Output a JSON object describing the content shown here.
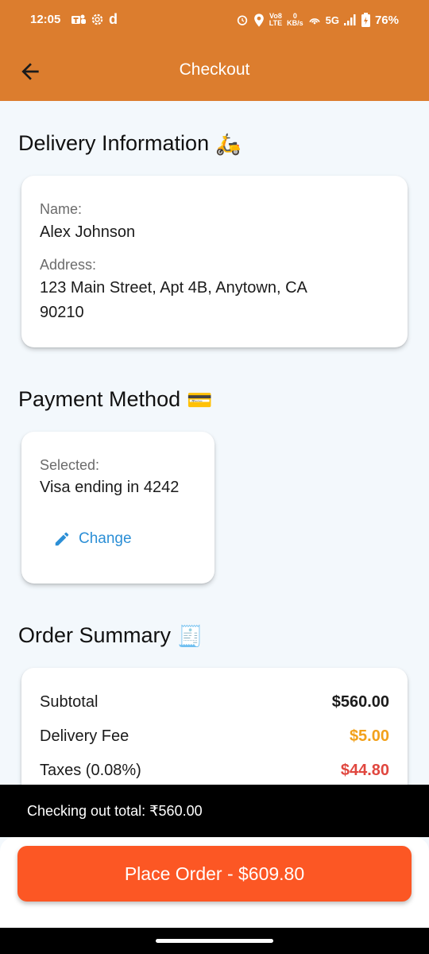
{
  "status_bar": {
    "time": "12:05",
    "left_icons": [
      "teams-icon",
      "settings-gear-icon",
      "d-icon"
    ],
    "volte": "Vo8\nLTE",
    "speed": "0\nKB/s",
    "network": "5G",
    "battery": "76%"
  },
  "appbar": {
    "title": "Checkout"
  },
  "delivery": {
    "title": "Delivery Information",
    "emoji": "🛵",
    "name_label": "Name:",
    "name_value": "Alex Johnson",
    "address_label": "Address:",
    "address_line1": "123 Main Street, Apt 4B, Anytown, CA",
    "address_line2": "90210"
  },
  "payment": {
    "title": "Payment Method",
    "emoji": "💳",
    "selected_label": "Selected:",
    "selected_value": "Visa ending in 4242",
    "change_label": "Change"
  },
  "summary": {
    "title": "Order Summary",
    "emoji": "🧾",
    "rows": [
      {
        "label": "Subtotal",
        "value": "$560.00",
        "color": "#1b1b1b"
      },
      {
        "label": "Delivery Fee",
        "value": "$5.00",
        "color": "#f2a11b"
      },
      {
        "label": "Taxes (0.08%)",
        "value": "$44.80",
        "color": "#e0473f"
      }
    ]
  },
  "snackbar": {
    "text": "Checking out total: ₹560.00"
  },
  "place_order": {
    "label": "Place Order - $609.80"
  },
  "colors": {
    "brand": "#dc7d2e",
    "button": "#fc5724",
    "link": "#2c8fd6",
    "background": "#f3f8fc"
  }
}
